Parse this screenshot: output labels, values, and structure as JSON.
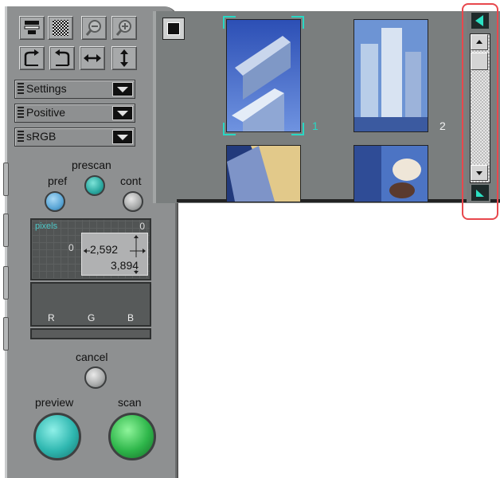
{
  "toolbar": {
    "row1": [
      "scan-mode-icon",
      "checker-icon",
      "zoom-out-icon",
      "zoom-in-icon"
    ],
    "row2": [
      "rotate-right-icon",
      "rotate-left-icon",
      "flip-horizontal-icon",
      "flip-vertical-icon"
    ]
  },
  "dropdowns": {
    "settings": "Settings",
    "film_type": "Positive",
    "color_space": "sRGB"
  },
  "buttons": {
    "prescan": "prescan",
    "pref": "pref",
    "cont": "cont",
    "cancel": "cancel",
    "preview": "preview",
    "scan": "scan"
  },
  "pixels": {
    "title": "pixels",
    "origin_top": "0",
    "origin_left": "0",
    "width": "2,592",
    "height": "3,894"
  },
  "histogram": {
    "channels": [
      "R",
      "G",
      "B"
    ]
  },
  "thumbnails": [
    {
      "number": "1",
      "selected": true
    },
    {
      "number": "2",
      "selected": false
    }
  ],
  "colors": {
    "panel": "#8e9091",
    "accent_teal": "#29d7c4",
    "prescan_led": "#2aa79f",
    "pref_led": "#5aa6d6",
    "preview_btn": "#2fb7b0",
    "scan_btn": "#2eb64a",
    "highlight": "#e8484d"
  }
}
